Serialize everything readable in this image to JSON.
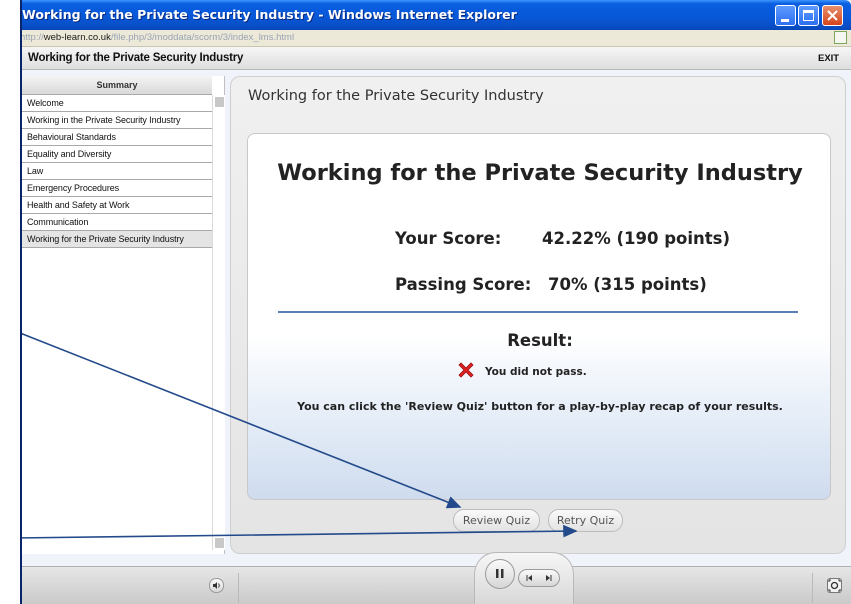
{
  "window": {
    "title": "Working for the Private Security Industry - Windows Internet Explorer",
    "url_prefix": "http://",
    "url_domain": "web-learn.co.uk",
    "url_path": "/file.php/3/moddata/scorm/3/index_lms.html"
  },
  "header": {
    "course_title": "Working for the Private Security Industry",
    "exit_label": "EXIT"
  },
  "sidebar": {
    "summary_label": "Summary",
    "items": [
      {
        "label": "Welcome"
      },
      {
        "label": "Working in the Private Security Industry"
      },
      {
        "label": "Behavioural Standards"
      },
      {
        "label": "Equality and Diversity"
      },
      {
        "label": "Law"
      },
      {
        "label": "Emergency Procedures"
      },
      {
        "label": "Health and Safety at Work"
      },
      {
        "label": "Communication"
      },
      {
        "label": "Working for the Private Security Industry",
        "active": true
      }
    ]
  },
  "slide": {
    "title": "Working for the Private Security Industry",
    "heading": "Working for the Private Security Industry",
    "your_score_label": "Your Score:",
    "your_score_value": "42.22% (190 points)",
    "passing_score_label": "Passing Score:",
    "passing_score_value": "70% (315 points)",
    "result_label": "Result:",
    "result_text": "You did not pass.",
    "result_icon": "red-x-icon",
    "hint": "You can click the 'Review Quiz' button for a play-by-play recap of your results."
  },
  "buttons": {
    "review": "Review Quiz",
    "retry": "Retry Quiz"
  },
  "player": {
    "icons": [
      "volume-icon",
      "pause-icon",
      "rewind-icon",
      "forward-icon",
      "fullscreen-icon"
    ]
  },
  "colors": {
    "titlebar": "#0758d8",
    "divider": "#5a7fb8",
    "fail": "#e02020",
    "annotation_arrow": "#234a8a"
  }
}
